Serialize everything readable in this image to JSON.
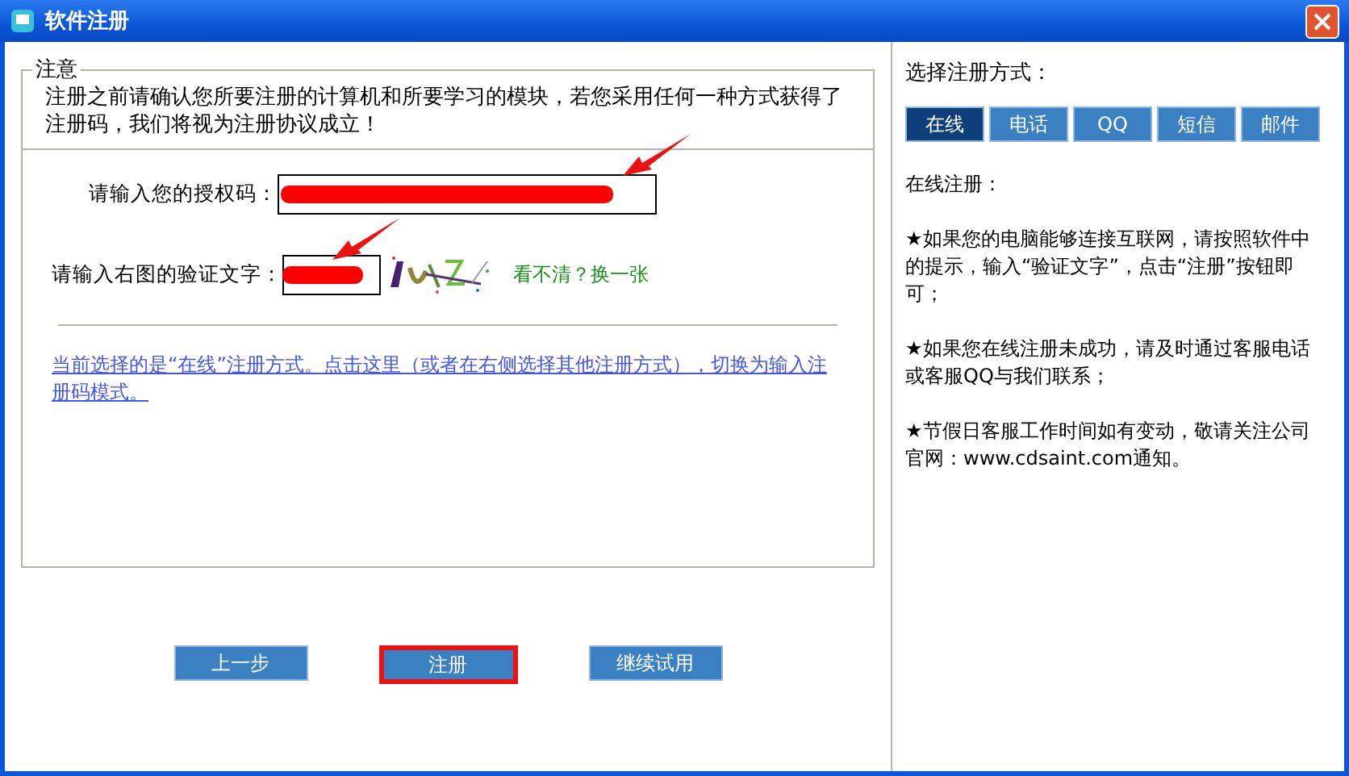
{
  "window": {
    "title": "软件注册"
  },
  "notice": {
    "legend": "注意",
    "text": "注册之前请确认您所要注册的计算机和所要学习的模块，若您采用任何一种方式获得了注册码，我们将视为注册协议成立！"
  },
  "form": {
    "fields": [
      {
        "label": "请输入您的授权码：",
        "kind": "code"
      },
      {
        "label": "请输入右图的验证文字：",
        "kind": "captcha"
      }
    ],
    "refresh_link": "看不清？换一张",
    "mode_link": "当前选择的是“在线”注册方式。点击这里（或者在右侧选择其他注册方式），切换为输入注册码模式。"
  },
  "buttons": [
    {
      "label": "上一步",
      "selected": false
    },
    {
      "label": "注册",
      "selected": true
    },
    {
      "label": "继续试用",
      "selected": false
    }
  ],
  "methods": {
    "heading": "选择注册方式：",
    "tabs": [
      {
        "label": "在线",
        "selected": true
      },
      {
        "label": "电话",
        "selected": false
      },
      {
        "label": "QQ",
        "selected": false
      },
      {
        "label": "短信",
        "selected": false
      },
      {
        "label": "邮件",
        "selected": false
      }
    ],
    "paragraphs": [
      "在线注册：",
      "★如果您的电脑能够连接互联网，请按照软件中的提示，输入“验证文字”，点击“注册”按钮即可；",
      "★如果您在线注册未成功，请及时通过客服电话或客服QQ与我们联系；",
      "★节假日客服工作时间如有变动，敬请关注公司官网：www.cdsaint.com通知。"
    ]
  }
}
